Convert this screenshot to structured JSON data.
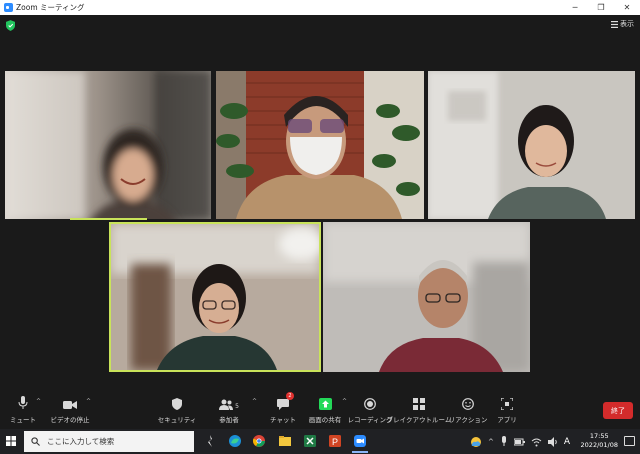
{
  "window": {
    "title": "Zoom ミーティング",
    "min_glyph": "─",
    "max_glyph": "❐",
    "close_glyph": "✕"
  },
  "header": {
    "view_label": "表示"
  },
  "toolbar": {
    "mute_label": "ミュート",
    "video_label": "ビデオの停止",
    "security_label": "セキュリティ",
    "participants_label": "参加者",
    "participants_count": "5",
    "chat_label": "チャット",
    "chat_badge": "2",
    "share_label": "画面の共有",
    "record_label": "レコーディング",
    "breakout_label": "ブレイクアウトルーム",
    "reaction_label": "リアクション",
    "apps_label": "アプリ",
    "end_label": "終了",
    "caret": "^"
  },
  "taskbar": {
    "search_placeholder": "ここに入力して検索",
    "ime_label": "A",
    "time": "17:55",
    "date": "2022/01/08"
  },
  "colors": {
    "active_speaker": "#c9e35a",
    "end_button": "#d32b2b",
    "share_green": "#23d959",
    "zoom_blue": "#2d8cff"
  }
}
